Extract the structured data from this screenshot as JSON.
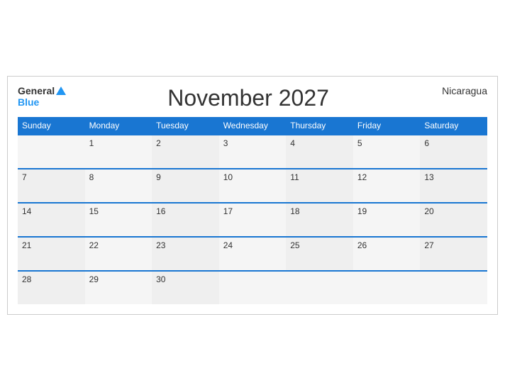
{
  "header": {
    "logo_general": "General",
    "logo_blue": "Blue",
    "month_title": "November 2027",
    "country": "Nicaragua"
  },
  "weekdays": [
    "Sunday",
    "Monday",
    "Tuesday",
    "Wednesday",
    "Thursday",
    "Friday",
    "Saturday"
  ],
  "weeks": [
    [
      "",
      "1",
      "2",
      "3",
      "4",
      "5",
      "6"
    ],
    [
      "7",
      "8",
      "9",
      "10",
      "11",
      "12",
      "13"
    ],
    [
      "14",
      "15",
      "16",
      "17",
      "18",
      "19",
      "20"
    ],
    [
      "21",
      "22",
      "23",
      "24",
      "25",
      "26",
      "27"
    ],
    [
      "28",
      "29",
      "30",
      "",
      "",
      "",
      ""
    ]
  ]
}
